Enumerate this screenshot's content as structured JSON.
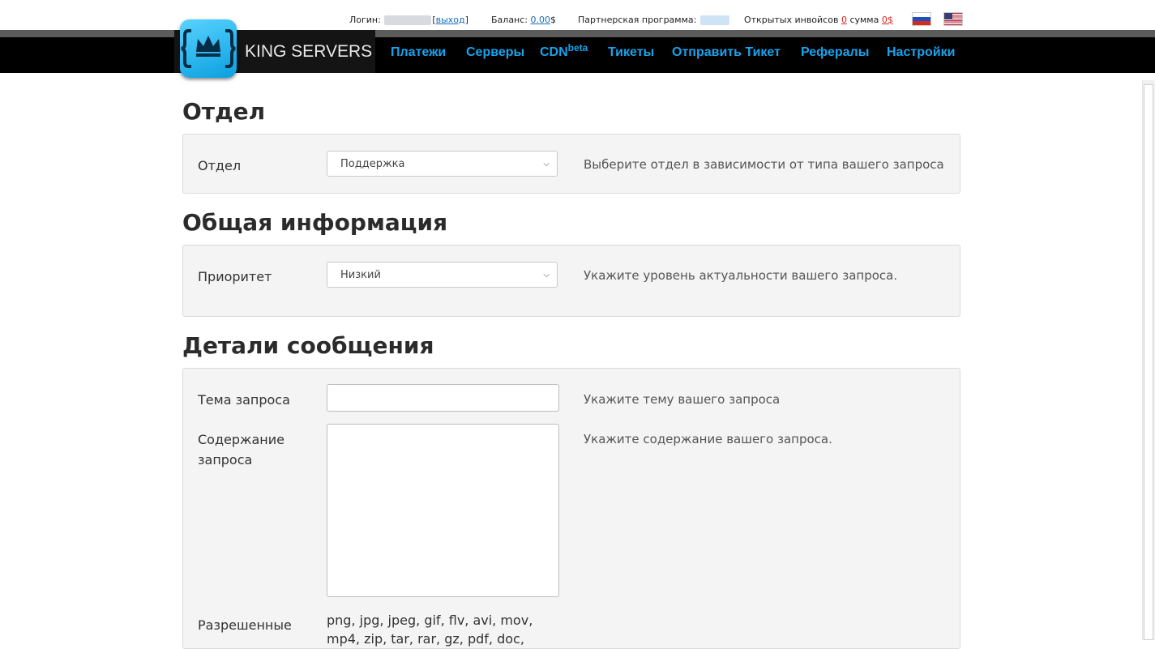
{
  "topbar": {
    "login_label": "Логин:",
    "logout_link": "выход",
    "balance_label": "Баланс:",
    "balance_value": "0.00",
    "currency": "$",
    "partner_label": "Партнерская программа:",
    "invoices_label": "Открытых инвойсов",
    "invoices_count": "0",
    "sum_label": "сумма",
    "sum_value": "0$"
  },
  "brand": {
    "name": "KING SERVERS"
  },
  "nav": {
    "payments": "Платежи",
    "servers": "Серверы",
    "cdn": "CDN",
    "cdn_badge": "beta",
    "tickets": "Тикеты",
    "send_ticket": "Отправить Тикет",
    "referrals": "Рефералы",
    "settings": "Настройки"
  },
  "sections": {
    "department": {
      "heading": "Отдел",
      "label": "Отдел",
      "selected": "Поддержка",
      "help": "Выберите отдел в зависимости от типа вашего запроса"
    },
    "general": {
      "heading": "Общая информация",
      "label": "Приоритет",
      "selected": "Низкий",
      "help": "Укажите уровень актуальности вашего запроса."
    },
    "details": {
      "heading": "Детали сообщения",
      "subject_label": "Тема запроса",
      "subject_value": "",
      "subject_help": "Укажите тему вашего запроса",
      "content_label_1": "Содержание",
      "content_label_2": "запроса",
      "content_value": "",
      "content_help": "Укажите содержание вашего запроса.",
      "allowed_label": "Разрешенные",
      "allowed_types_1": "png, jpg, jpeg, gif, flv, avi, mov,",
      "allowed_types_2": "mp4, zip, tar, rar, gz, pdf, doc,"
    }
  },
  "colors": {
    "accent": "#17a3ee",
    "nav_bg": "#000000",
    "panel_bg": "#f4f4f4",
    "link_red": "#d6251f"
  }
}
